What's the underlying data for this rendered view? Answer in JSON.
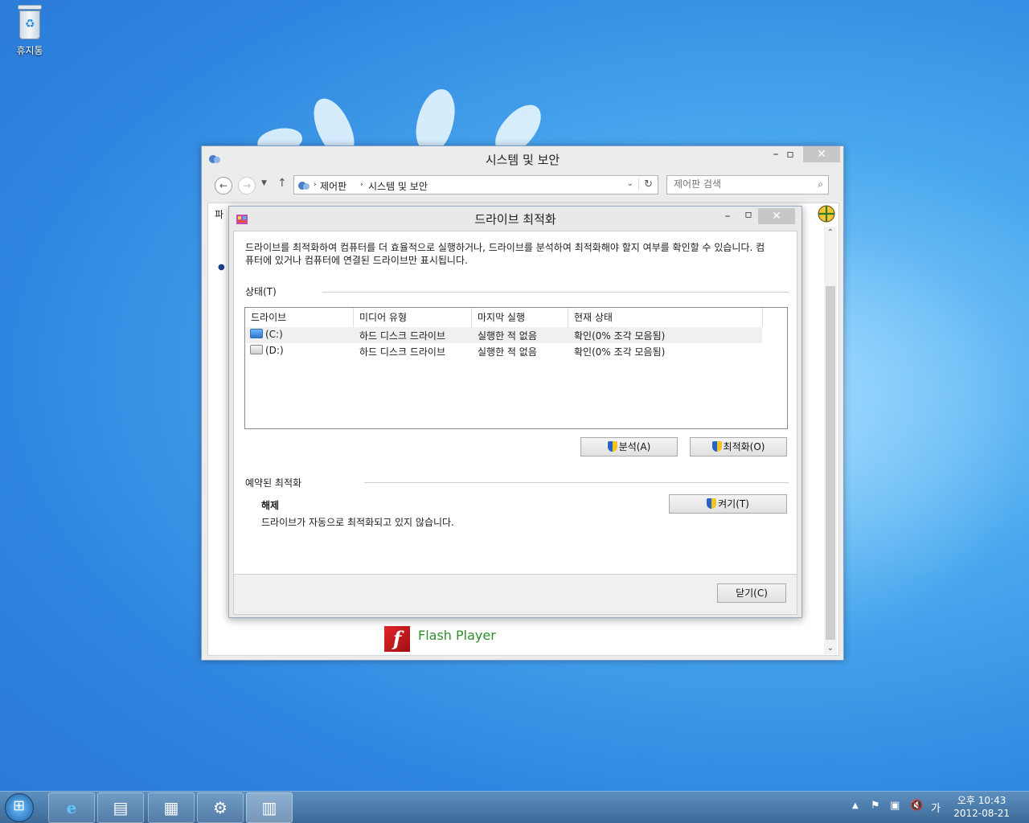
{
  "desktop": {
    "recycle_bin_label": "휴지통"
  },
  "main_window": {
    "title": "시스템 및 보안",
    "breadcrumb": [
      "제어판",
      "시스템 및 보안"
    ],
    "search_placeholder": "제어판 검색",
    "menu_fragment": "파",
    "flash_label": "Flash Player"
  },
  "dialog": {
    "title": "드라이브 최적화",
    "description": "드라이브를 최적화하여 컴퓨터를 더 효율적으로 실행하거나, 드라이브를 분석하여 최적화해야 할지 여부를 확인할 수 있습니다. 컴퓨터에 있거나 컴퓨터에 연결된 드라이브만 표시됩니다.",
    "status_label": "상태(T)",
    "columns": [
      "드라이브",
      "미디어 유형",
      "마지막 실행",
      "현재 상태"
    ],
    "drives": [
      {
        "name": "(C:)",
        "media": "하드 디스크 드라이브",
        "last_run": "실행한 적 없음",
        "status": "확인(0% 조각 모음됨)"
      },
      {
        "name": "(D:)",
        "media": "하드 디스크 드라이브",
        "last_run": "실행한 적 없음",
        "status": "확인(0% 조각 모음됨)"
      }
    ],
    "analyze_button": "분석(A)",
    "optimize_button": "최적화(O)",
    "scheduled_label": "예약된 최적화",
    "scheduled_state": "해제",
    "scheduled_desc": "드라이브가 자동으로 최적화되고 있지 않습니다.",
    "turn_on_button": "켜기(T)",
    "close_button": "닫기(C)"
  },
  "taskbar": {
    "tray_lang": "가",
    "clock_time": "오후 10:43",
    "clock_date": "2012-08-21"
  }
}
